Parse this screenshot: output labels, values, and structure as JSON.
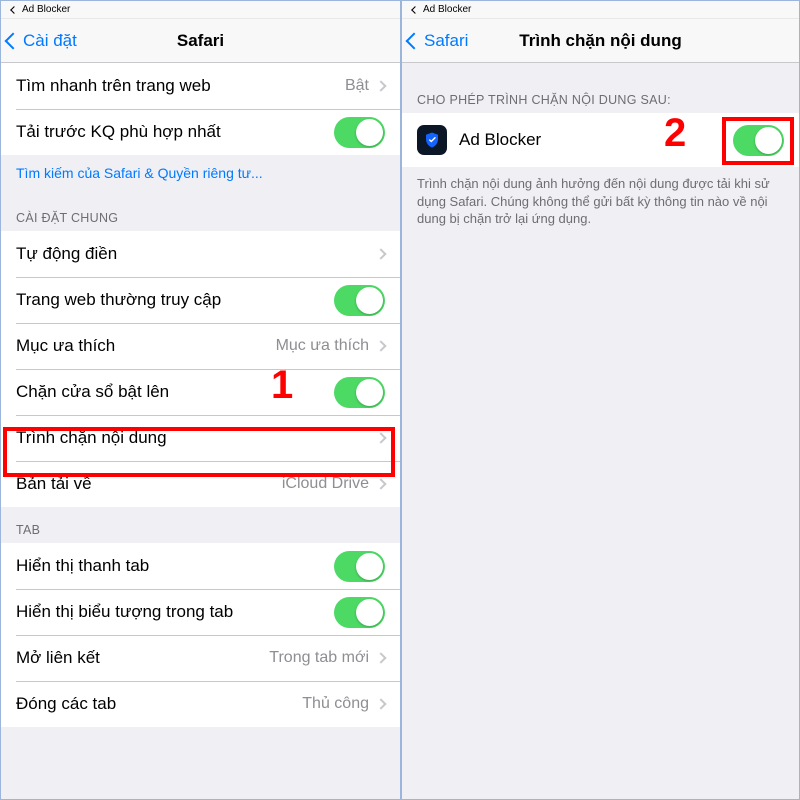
{
  "left": {
    "status_app": "Ad Blocker",
    "back_label": "Cài đặt",
    "title": "Safari",
    "rows_top": [
      {
        "label": "Tìm nhanh trên trang web",
        "value": "Bật",
        "kind": "disclosure"
      },
      {
        "label": "Tải trước KQ phù hợp nhất",
        "kind": "toggle_on"
      }
    ],
    "hint": "Tìm kiếm của Safari & Quyền riêng tư...",
    "section_general": "CÀI ĐẶT CHUNG",
    "rows_general": [
      {
        "label": "Tự động điền",
        "value": "",
        "kind": "disclosure"
      },
      {
        "label": "Trang web thường truy cập",
        "kind": "toggle_on"
      },
      {
        "label": "Mục ưa thích",
        "value": "Mục ưa thích",
        "kind": "disclosure"
      },
      {
        "label": "Chặn cửa sổ bật lên",
        "kind": "toggle_on"
      },
      {
        "label": "Trình chặn nội dung",
        "value": "",
        "kind": "disclosure"
      },
      {
        "label": "Bản tải về",
        "value": "iCloud Drive",
        "kind": "disclosure"
      }
    ],
    "section_tab": "TAB",
    "rows_tab": [
      {
        "label": "Hiển thị thanh tab",
        "kind": "toggle_on"
      },
      {
        "label": "Hiển thị biểu tượng trong tab",
        "kind": "toggle_on"
      },
      {
        "label": "Mở liên kết",
        "value": "Trong tab mới",
        "kind": "disclosure"
      },
      {
        "label": "Đóng các tab",
        "value": "Thủ công",
        "kind": "disclosure"
      }
    ],
    "annotation_number": "1"
  },
  "right": {
    "status_app": "Ad Blocker",
    "back_label": "Safari",
    "title": "Trình chặn nội dung",
    "section_header": "CHO PHÉP TRÌNH CHẶN NỘI DUNG SAU:",
    "blocker_label": "Ad Blocker",
    "footer": "Trình chặn nội dung ảnh hưởng đến nội dung được tải khi sử dụng Safari. Chúng không thể gửi bất kỳ thông tin nào về nội dung bị chặn trở lại ứng dụng.",
    "annotation_number": "2"
  }
}
